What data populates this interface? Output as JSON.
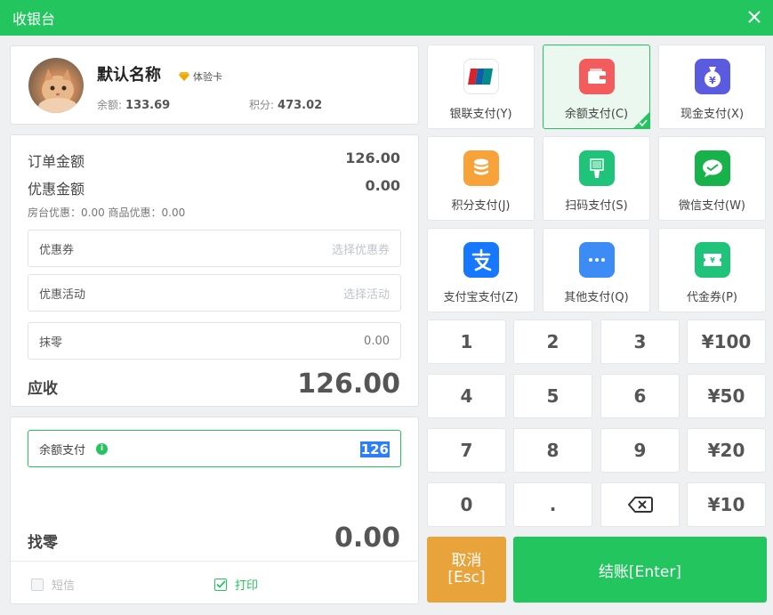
{
  "window": {
    "title": "收银台"
  },
  "member": {
    "name": "默认名称",
    "card_type": "体验卡",
    "balance_label": "余额:",
    "balance": "133.69",
    "points_label": "积分:",
    "points": "473.02"
  },
  "order": {
    "order_amount_label": "订单金额",
    "order_amount": "126.00",
    "discount_label": "优惠金额",
    "discount": "0.00",
    "discount_detail": "房台优惠：0.00  商品优惠：0.00",
    "coupon_label": "优惠券",
    "coupon_placeholder": "选择优惠券",
    "promo_label": "优惠活动",
    "promo_placeholder": "选择活动",
    "round_label": "抹零",
    "round_value": "0.00",
    "due_label": "应收",
    "due": "126.00"
  },
  "payment": {
    "method_label": "余额支付",
    "amount": "126",
    "change_label": "找零",
    "change": "0.00",
    "sms_label": "短信",
    "sms_checked": false,
    "print_label": "打印",
    "print_checked": true
  },
  "methods": [
    {
      "label": "银联支付(Y)",
      "icon": "unionpay-icon",
      "selected": false
    },
    {
      "label": "余额支付(C)",
      "icon": "wallet-icon",
      "selected": true
    },
    {
      "label": "现金支付(X)",
      "icon": "money-bag-icon",
      "selected": false
    },
    {
      "label": "积分支付(J)",
      "icon": "coins-icon",
      "selected": false
    },
    {
      "label": "扫码支付(S)",
      "icon": "barcode-scanner-icon",
      "selected": false
    },
    {
      "label": "微信支付(W)",
      "icon": "wechat-icon",
      "selected": false
    },
    {
      "label": "支付宝支付(Z)",
      "icon": "alipay-icon",
      "selected": false
    },
    {
      "label": "其他支付(Q)",
      "icon": "more-icon",
      "selected": false
    },
    {
      "label": "代金券(P)",
      "icon": "voucher-icon",
      "selected": false
    }
  ],
  "keypad": {
    "k1": "1",
    "k2": "2",
    "k3": "3",
    "k100": "¥100",
    "k4": "4",
    "k5": "5",
    "k6": "6",
    "k50": "¥50",
    "k7": "7",
    "k8": "8",
    "k9": "9",
    "k20": "¥20",
    "k0": "0",
    "kdot": ".",
    "k10": "¥10"
  },
  "actions": {
    "cancel_line1": "取消",
    "cancel_line2": "[Esc]",
    "checkout": "结账[Enter]"
  },
  "colors": {
    "accent": "#22c55e",
    "cancel": "#e8a33a",
    "selection": "#2d7ff9"
  }
}
